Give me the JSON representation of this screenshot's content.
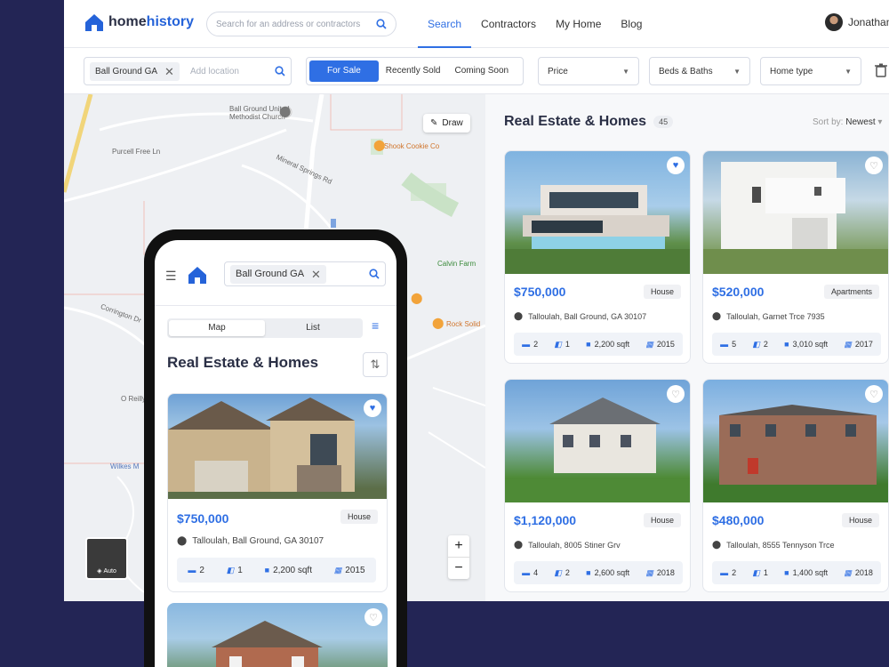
{
  "app": {
    "brand_a": "home",
    "brand_b": "history"
  },
  "header": {
    "search_placeholder": "Search for an address or contractors",
    "nav": [
      "Search",
      "Contractors",
      "My Home",
      "Blog"
    ],
    "active_nav": "Search",
    "user_name": "Jonathan"
  },
  "filters": {
    "location_chip": "Ball Ground GA",
    "location_placeholder": "Add location",
    "segments": [
      "For Sale",
      "Recently Sold",
      "Coming Soon"
    ],
    "price": "Price",
    "beds": "Beds & Baths",
    "hometype": "Home type"
  },
  "map": {
    "draw": "Draw",
    "auto": "Auto",
    "labels": [
      "Ball Ground United Methodist Church",
      "Shook Cookie Co",
      "Calvin Farm",
      "Rock Solid",
      "Purcell Free Ln",
      "Mineral Springs Rd",
      "O Reilly",
      "Wilkes M",
      "Corrington Dr"
    ]
  },
  "results": {
    "title": "Real Estate & Homes",
    "count": "45",
    "sort_label": "Sort by:",
    "sort_value": "Newest",
    "cards": [
      {
        "price": "$750,000",
        "type": "House",
        "address": "Talloulah, Ball Ground, GA 30107",
        "beds": "2",
        "baths": "1",
        "sqft": "2,200 sqft",
        "year": "2015",
        "fav": true
      },
      {
        "price": "$520,000",
        "type": "Apartments",
        "address": "Talloulah, Garnet Trce 7935",
        "beds": "5",
        "baths": "2",
        "sqft": "3,010 sqft",
        "year": "2017",
        "fav": false
      },
      {
        "price": "$1,120,000",
        "type": "House",
        "address": "Talloulah, 8005 Stiner Grv",
        "beds": "4",
        "baths": "2",
        "sqft": "2,600 sqft",
        "year": "2018",
        "fav": false
      },
      {
        "price": "$480,000",
        "type": "House",
        "address": "Talloulah, 8555 Tennyson Trce",
        "beds": "2",
        "baths": "1",
        "sqft": "1,400 sqft",
        "year": "2018",
        "fav": false
      }
    ]
  },
  "mobile": {
    "search_value": "Ball Ground GA",
    "tabs": [
      "Map",
      "List"
    ],
    "title": "Real Estate & Homes",
    "card": {
      "price": "$750,000",
      "type": "House",
      "address": "Talloulah, Ball Ground, GA 30107",
      "beds": "2",
      "baths": "1",
      "sqft": "2,200 sqft",
      "year": "2015"
    }
  },
  "colors": {
    "accent": "#2f6fe4",
    "background": "#232555"
  }
}
